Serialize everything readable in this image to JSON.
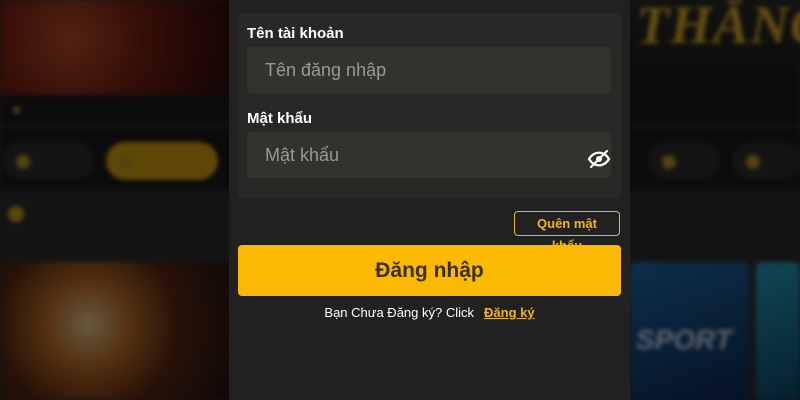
{
  "background": {
    "banner_text": "THẮNG"
  },
  "login": {
    "username": {
      "label": "Tên tài khoản",
      "placeholder": "Tên đăng nhập",
      "value": ""
    },
    "password": {
      "label": "Mật khẩu",
      "placeholder": "Mật khẩu",
      "value": "",
      "toggle_icon": "eye-slash-icon"
    },
    "forgot_label": "Quên mật khẩu",
    "submit_label": "Đăng nhập",
    "signup_prompt": "Bạn Chưa Đăng ký? Click",
    "signup_link": "Đăng ký"
  },
  "colors": {
    "accent": "#fbb904",
    "panel": "#212121",
    "field": "#33332e",
    "text": "#ffffff"
  }
}
